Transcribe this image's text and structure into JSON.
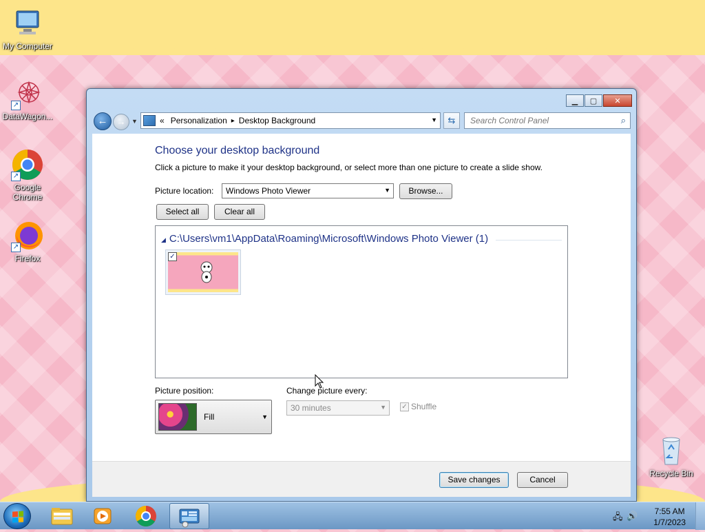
{
  "desktop": {
    "icons": [
      {
        "label": "My Computer"
      },
      {
        "label": "DataWagon..."
      },
      {
        "label": "Google Chrome"
      },
      {
        "label": "Firefox"
      },
      {
        "label": "Recycle Bin"
      }
    ]
  },
  "window": {
    "controls": {
      "minimize": "▁",
      "maximize": "▢",
      "close": "✕"
    },
    "breadcrumb": {
      "overflow": "«",
      "items": [
        "Personalization",
        "Desktop Background"
      ],
      "separator": "▸"
    },
    "search": {
      "placeholder": "Search Control Panel"
    },
    "heading": "Choose your desktop background",
    "instructions": "Click a picture to make it your desktop background, or select more than one picture to create a slide show.",
    "picture_location": {
      "label": "Picture location:",
      "value": "Windows Photo Viewer",
      "browse_label": "Browse..."
    },
    "select_all_label": "Select all",
    "clear_all_label": "Clear all",
    "gallery": {
      "group_title": "C:\\Users\\vm1\\AppData\\Roaming\\Microsoft\\Windows Photo Viewer (1)",
      "items": [
        {
          "checked": true
        }
      ]
    },
    "picture_position": {
      "label": "Picture position:",
      "value": "Fill"
    },
    "change_picture": {
      "label": "Change picture every:",
      "value": "30 minutes",
      "disabled": true
    },
    "shuffle": {
      "label": "Shuffle",
      "checked": true,
      "disabled": true
    },
    "save_label": "Save changes",
    "cancel_label": "Cancel"
  },
  "taskbar": {
    "items": [
      "start-button",
      "windows-explorer",
      "media-player",
      "google-chrome",
      "control-panel"
    ],
    "active_item": "control-panel",
    "clock": {
      "time": "7:55 AM",
      "date": "1/7/2023"
    }
  }
}
